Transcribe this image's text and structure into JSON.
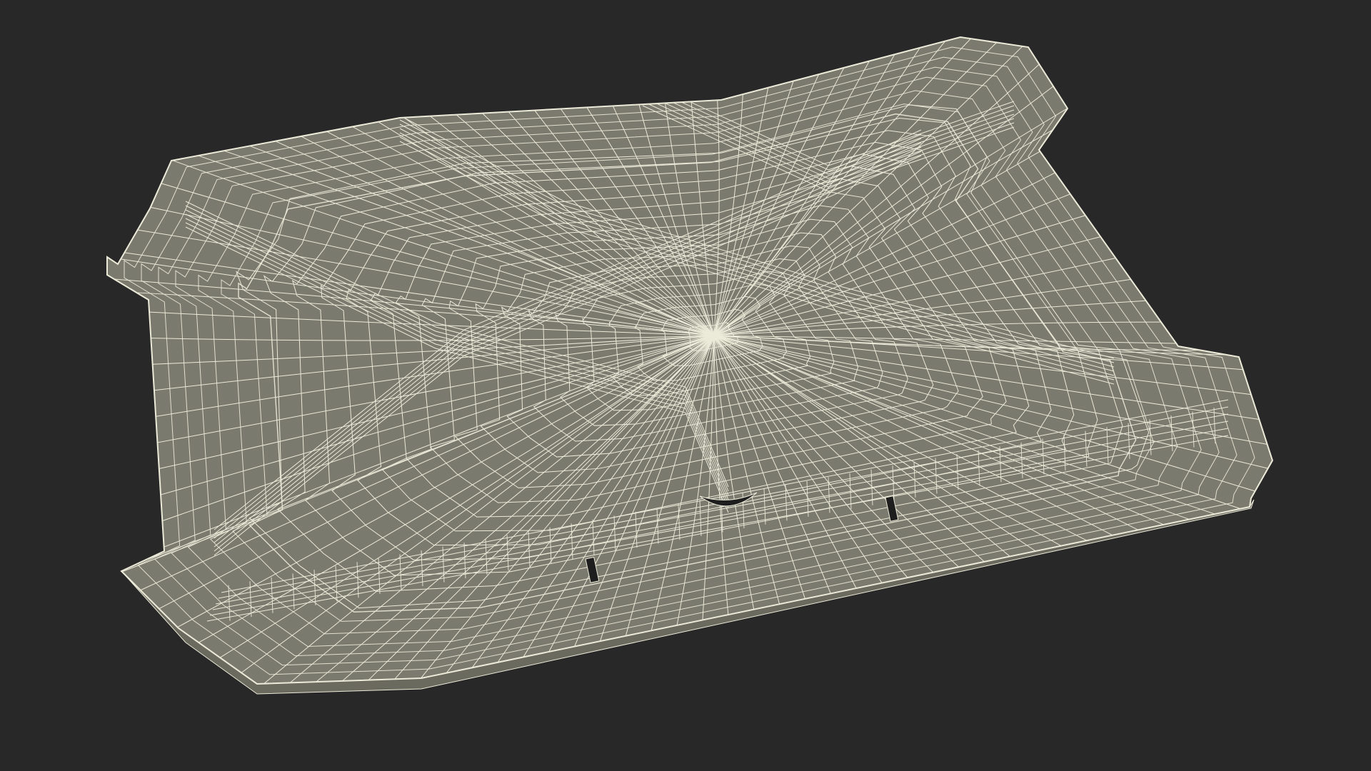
{
  "scene": {
    "background_color": "#282828",
    "model_fill_color": "#7a7a6e",
    "model_side_color": "#6a6a5f",
    "wire_color": "#ecead8",
    "slot_color": "#1e1e1e",
    "subject": "wireframe-tray-model"
  }
}
